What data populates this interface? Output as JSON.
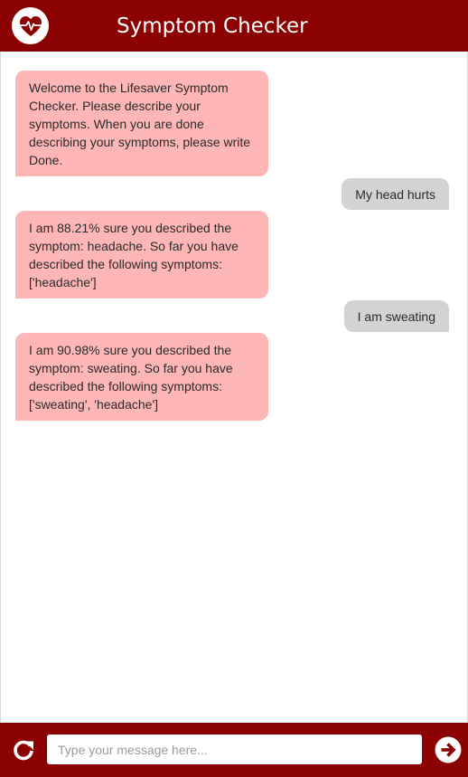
{
  "header": {
    "title": "Symptom Checker",
    "logo_icon": "heart-pulse-icon"
  },
  "messages": [
    {
      "sender": "bot",
      "text": "Welcome to the Lifesaver Symptom Checker. Please describe your symptoms. When you are done describing your symptoms, please write Done."
    },
    {
      "sender": "user",
      "text": "My head hurts"
    },
    {
      "sender": "bot",
      "text": "I am 88.21% sure you described the symptom: headache. So far you have described the following symptoms: ['headache']"
    },
    {
      "sender": "user",
      "text": "I am sweating"
    },
    {
      "sender": "bot",
      "text": "I am 90.98% sure you described the symptom: sweating. So far you have described the following symptoms: ['sweating', 'headache']"
    }
  ],
  "footer": {
    "refresh_icon": "refresh-icon",
    "input_placeholder": "Type your message here...",
    "input_value": "",
    "send_icon": "send-arrow-icon"
  },
  "colors": {
    "brand": "#8b0000",
    "bot_bubble": "#ffb6b6",
    "user_bubble": "#d3d3d3"
  }
}
